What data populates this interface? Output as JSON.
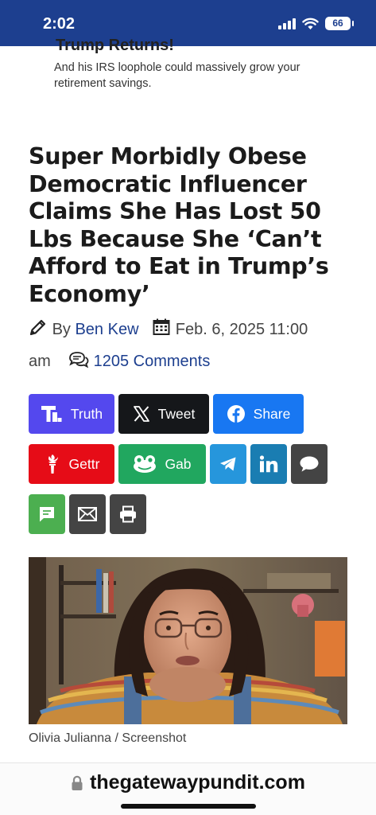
{
  "status_bar": {
    "time": "2:02",
    "battery": "66"
  },
  "ad": {
    "title": "Trump Returns!",
    "text": "And his IRS loophole could massively grow your retirement savings."
  },
  "article": {
    "headline": "Super Morbidly Obese Democratic Influencer Claims She Has Lost 50 Lbs Because She ‘Can’t Afford to Eat in Trump’s Economy’",
    "by": "By",
    "author": "Ben Kew",
    "date_part1": "Feb. 6, 2025 11:00",
    "date_part2": "am",
    "comments": "1205 Comments"
  },
  "share_buttons": {
    "truth": "Truth",
    "tweet": "Tweet",
    "share": "Share",
    "gettr": "Gettr",
    "gab": "Gab"
  },
  "colors": {
    "truth": "#5448ee",
    "tweet": "#15171a",
    "share": "#1877f2",
    "gettr": "#e60c17",
    "gab": "#21a75f",
    "telegram": "#2696dc",
    "linkedin": "#1a7db2",
    "comment": "#444444",
    "sms": "#4caf50",
    "email": "#444444",
    "print": "#444444"
  },
  "image": {
    "caption": "Olivia Julianna / Screenshot"
  },
  "browser": {
    "url": "thegatewaypundit.com"
  }
}
